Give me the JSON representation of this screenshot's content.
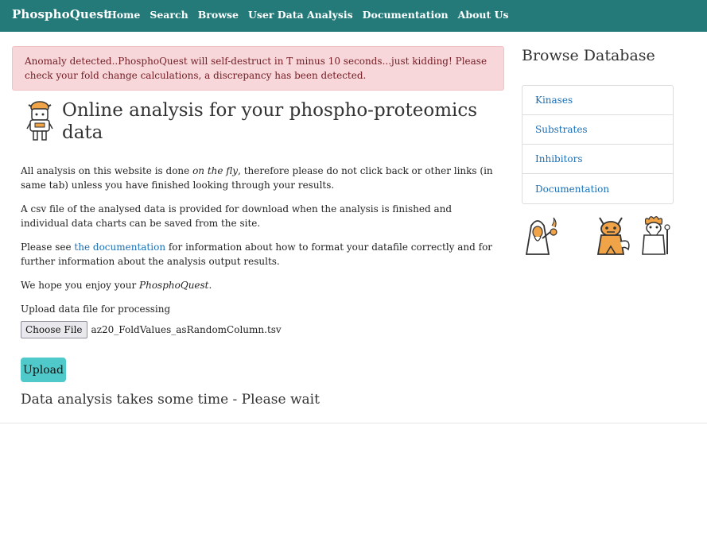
{
  "navbar": {
    "brand": "PhosphoQuest",
    "items": [
      "Home",
      "Search",
      "Browse",
      "User Data Analysis",
      "Documentation",
      "About Us"
    ]
  },
  "alert": {
    "text": "Anomaly detected..PhosphoQuest will self-destruct in T minus 10 seconds...just kidding! Please check your fold change calculations, a discrepancy has been detected."
  },
  "main": {
    "title": "Online analysis for your phospho-proteomics data",
    "p1_pre": "All analysis on this website is done ",
    "p1_em": "on the fly",
    "p1_post": ", therefore please do not click back or other links (in same tab) unless you have finished looking through your results.",
    "p2": "A csv file of the analysed data is provided for download when the analysis is finished and individual data charts can be saved from the site.",
    "p3_pre": "Please see ",
    "p3_link": "the documentation",
    "p3_post": " for information about how to format your datafile correctly and for further information about the analysis output results.",
    "p4_pre": "We hope you enjoy your ",
    "p4_em": "PhosphoQuest",
    "p4_post": ".",
    "upload_label": "Upload data file for processing",
    "choose_file_label": "Choose File",
    "file_name": "az20_FoldValues_asRandomColumn.tsv",
    "upload_button": "Upload",
    "wait_text": "Data analysis takes some time - Please wait"
  },
  "sidebar": {
    "title": "Browse Database",
    "items": [
      "Kinases",
      "Substrates",
      "Inhibitors",
      "Documentation"
    ]
  },
  "colors": {
    "navbar": "#237a78",
    "alert_bg": "#f8d7da",
    "alert_text": "#721c24",
    "link": "#1a6fb5",
    "upload_button": "#4fc9c9",
    "accent_orange": "#f0a347"
  },
  "icons": [
    "robot-mascot-icon",
    "wizard-character-icon",
    "monster-character-icon",
    "fire-sage-character-icon"
  ]
}
